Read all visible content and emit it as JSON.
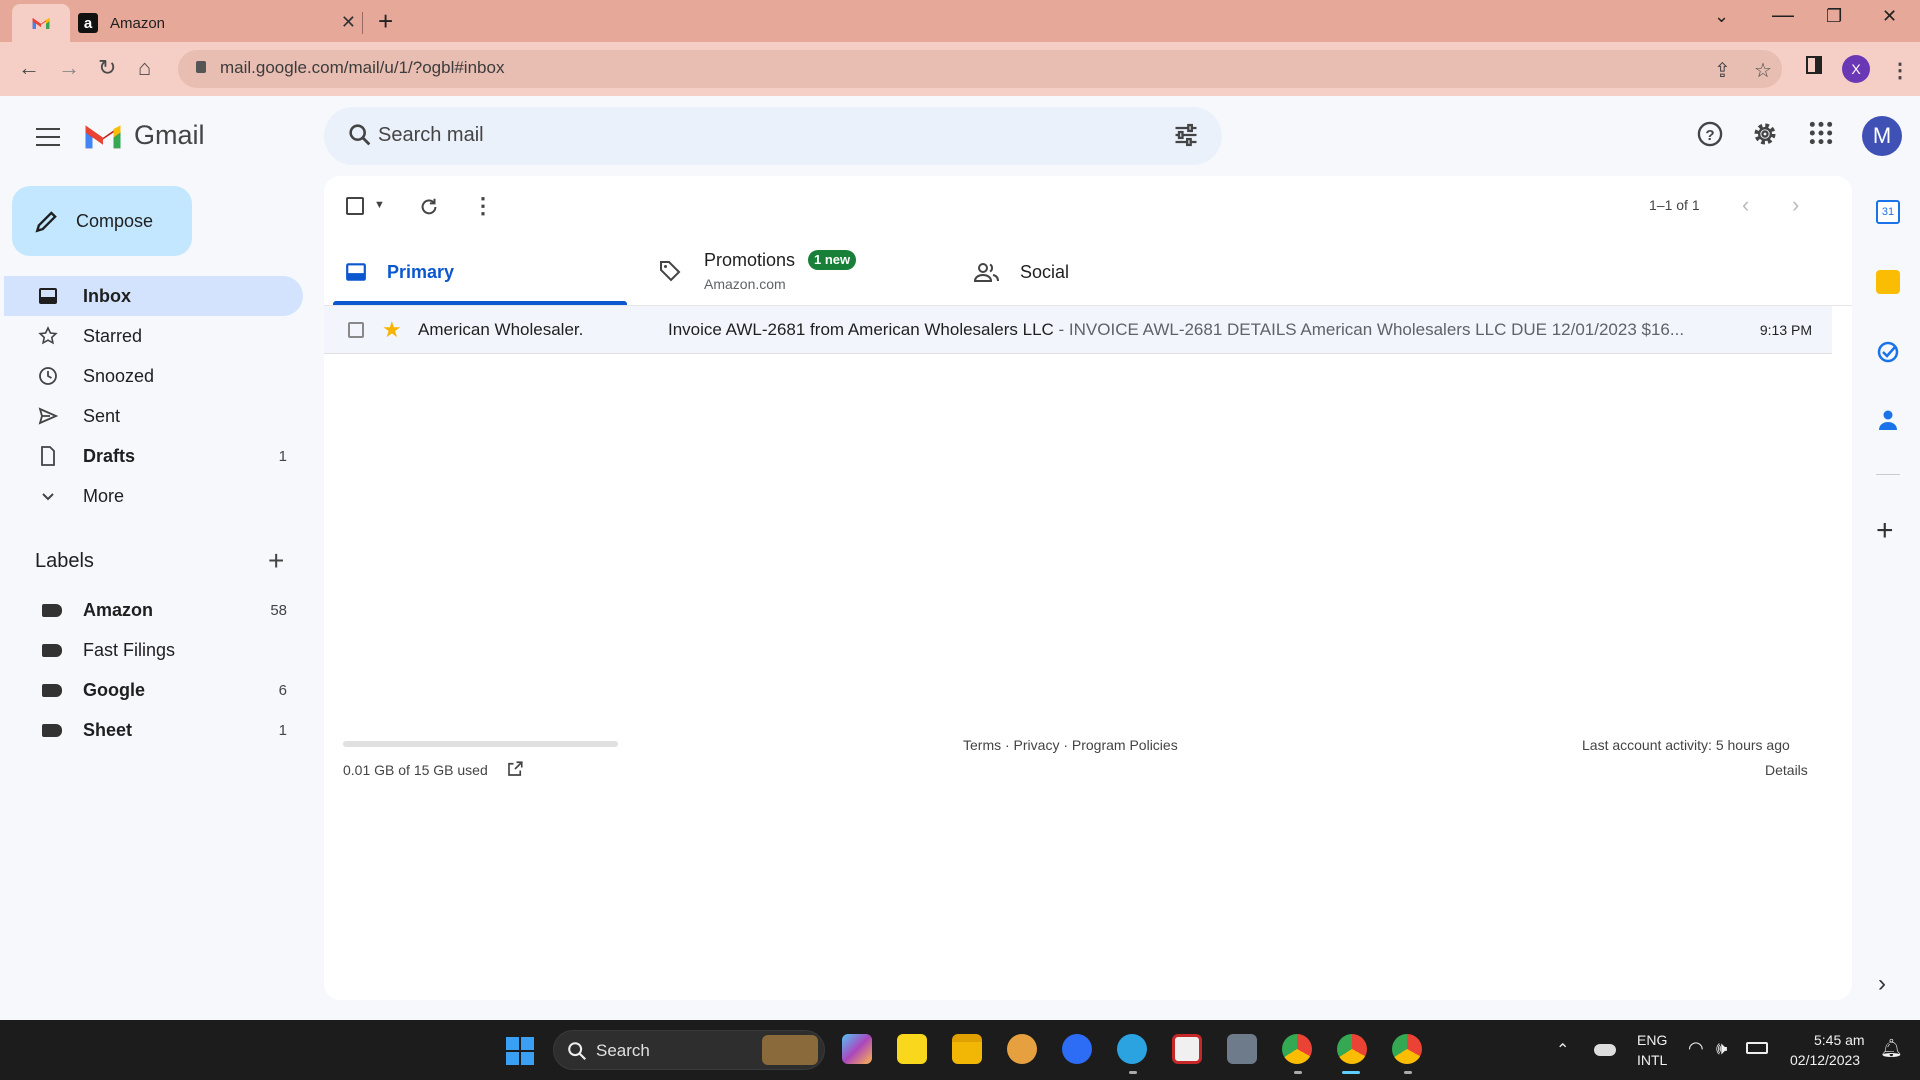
{
  "browser": {
    "tab_title": "Amazon",
    "tab_favicon": "a",
    "url": "mail.google.com/mail/u/1/?ogbl#inbox",
    "profile_initial": "X"
  },
  "gmail": {
    "brand": "Gmail",
    "search_placeholder": "Search mail",
    "account_initial": "M",
    "compose_label": "Compose",
    "nav": [
      {
        "label": "Inbox",
        "count": "",
        "bold": true
      },
      {
        "label": "Starred",
        "count": ""
      },
      {
        "label": "Snoozed",
        "count": ""
      },
      {
        "label": "Sent",
        "count": ""
      },
      {
        "label": "Drafts",
        "count": "1",
        "bold": true
      },
      {
        "label": "More",
        "count": ""
      }
    ],
    "labels_heading": "Labels",
    "labels": [
      {
        "label": "Amazon",
        "count": "58"
      },
      {
        "label": "Fast Filings",
        "count": ""
      },
      {
        "label": "Google",
        "count": "6"
      },
      {
        "label": "Sheet",
        "count": "1"
      }
    ],
    "pagination": "1–1 of 1",
    "tabs": {
      "primary": "Primary",
      "promotions": "Promotions",
      "promotions_badge": "1 new",
      "promotions_sub": "Amazon.com",
      "social": "Social"
    },
    "emails": [
      {
        "sender": "American Wholesaler.",
        "subject": "Invoice AWL-2681 from American Wholesalers LLC",
        "snippet": " - INVOICE AWL-2681 DETAILS American Wholesalers LLC DUE 12/01/2023 $16...",
        "time": "9:13 PM",
        "starred": true
      }
    ],
    "footer": {
      "storage": "0.01 GB of 15 GB used",
      "links": "Terms · Privacy · Program Policies",
      "activity": "Last account activity: 5 hours ago",
      "details": "Details"
    }
  },
  "taskbar": {
    "search_label": "Search",
    "lang1": "ENG",
    "lang2": "INTL",
    "time": "5:45 am",
    "date": "02/12/2023"
  }
}
